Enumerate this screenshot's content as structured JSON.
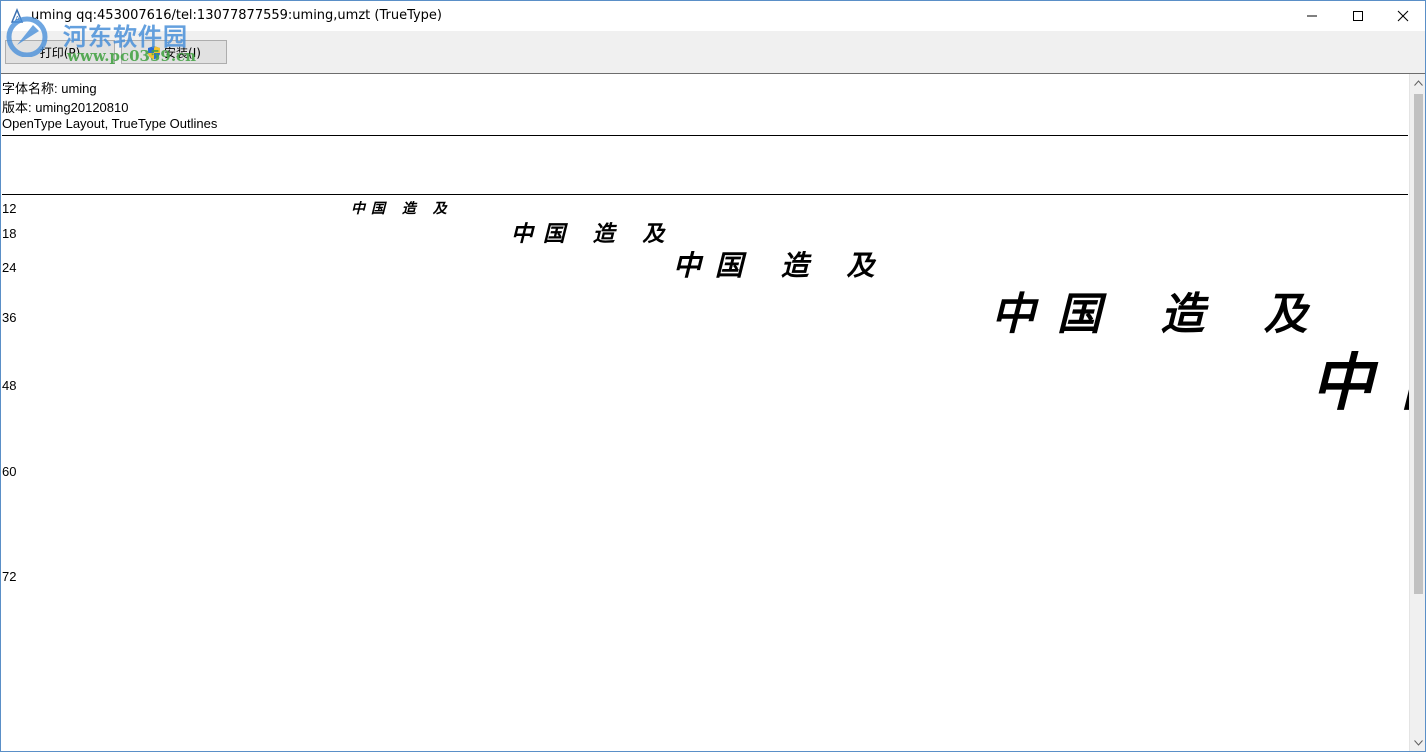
{
  "window": {
    "title": "uming qq:453007616/tel:13077877559:uming,umzt (TrueType)"
  },
  "toolbar": {
    "print_label": "打印(P)",
    "install_label": "安装(I)"
  },
  "watermark": {
    "site_name": "河东软件园",
    "url": "www.pc0359.cn"
  },
  "font_info": {
    "name_line": "字体名称: uming",
    "version_line": "版本: uming20120810",
    "type_line": "OpenType Layout, TrueType Outlines"
  },
  "samples": {
    "text": "中国 造 及",
    "sizes": [
      "12",
      "18",
      "24",
      "36",
      "48",
      "60",
      "72"
    ]
  },
  "colors": {
    "window_border": "#5a8fc7",
    "toolbar_bg": "#f0f0f0",
    "watermark_blue": "#4a90d9",
    "watermark_green": "#47a447"
  }
}
